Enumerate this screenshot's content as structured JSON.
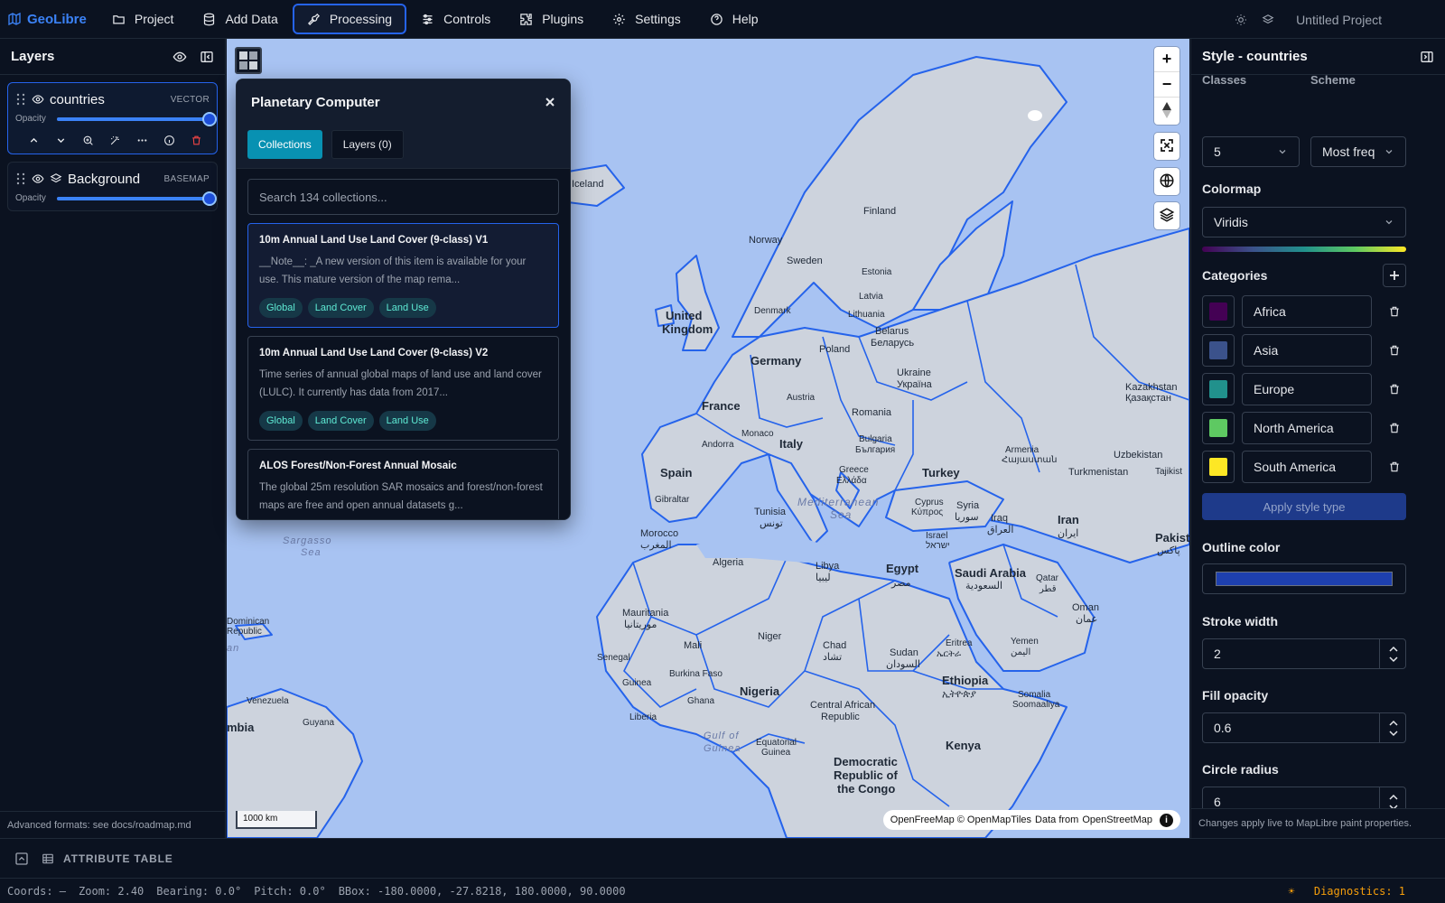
{
  "app": {
    "name": "GeoLibre",
    "project": "Untitled Project"
  },
  "menu": [
    {
      "label": "Project",
      "icon": "folder-icon"
    },
    {
      "label": "Add Data",
      "icon": "database-icon"
    },
    {
      "label": "Processing",
      "icon": "wrench-icon",
      "active": true
    },
    {
      "label": "Controls",
      "icon": "sliders-icon"
    },
    {
      "label": "Plugins",
      "icon": "puzzle-icon"
    },
    {
      "label": "Settings",
      "icon": "gear-icon"
    },
    {
      "label": "Help",
      "icon": "help-icon"
    }
  ],
  "layers_panel": {
    "title": "Layers",
    "layers": [
      {
        "name": "countries",
        "type": "VECTOR",
        "opacity_label": "Opacity",
        "opacity": 1.0
      },
      {
        "name": "Background",
        "type": "BASEMAP",
        "opacity_label": "Opacity",
        "opacity": 1.0
      }
    ],
    "footer": "Advanced formats: see docs/roadmap.md"
  },
  "planetary": {
    "title": "Planetary Computer",
    "tab_collections": "Collections",
    "tab_layers": "Layers (0)",
    "search_placeholder": "Search 134 collections...",
    "collections": [
      {
        "title": "10m Annual Land Use Land Cover (9-class) V1",
        "desc": "__Note__: _A new version of this item is available for your use. This mature version of the map rema...",
        "tags": [
          "Global",
          "Land Cover",
          "Land Use"
        ]
      },
      {
        "title": "10m Annual Land Use Land Cover (9-class) V2",
        "desc": "Time series of annual global maps of land use and land cover (LULC). It currently has data from 2017...",
        "tags": [
          "Global",
          "Land Cover",
          "Land Use"
        ]
      },
      {
        "title": "ALOS Forest/Non-Forest Annual Mosaic",
        "desc": "The global 25m resolution SAR mosaics and forest/non-forest maps are free and open annual datasets g...",
        "tags": []
      }
    ]
  },
  "map": {
    "scale": "1000 km",
    "attribution_a": "OpenFreeMap © OpenMapTiles",
    "attribution_b": "Data from",
    "attribution_c": "OpenStreetMap",
    "labels": {
      "iceland": "Iceland",
      "norway": "Norway",
      "sweden": "Sweden",
      "finland": "Finland",
      "estonia": "Estonia",
      "latvia": "Latvia",
      "lithuania": "Lithuania",
      "uk1": "United",
      "uk2": "Kingdom",
      "denmark": "Denmark",
      "belarus1": "Belarus",
      "belarus2": "Беларусь",
      "poland": "Poland",
      "germany": "Germany",
      "ukraine1": "Ukraine",
      "ukraine2": "Україна",
      "france": "France",
      "austria": "Austria",
      "romania": "Romania",
      "andorra": "Andorra",
      "monaco": "Monaco",
      "italy": "Italy",
      "bulgaria1": "Bulgaria",
      "bulgaria2": "България",
      "spain": "Spain",
      "greece1": "Greece",
      "greece2": "Ελλάδα",
      "turkey": "Turkey",
      "gibraltar": "Gibraltar",
      "kazakhstan1": "Kazakhstan",
      "kazakhstan2": "Қазақстан",
      "armenia1": "Armenia",
      "armenia2": "Հայաստան",
      "uzbekistan": "Uzbekistan",
      "turkmenistan": "Turkmenistan",
      "tajikistan": "Tajikist",
      "med1": "Mediterranean",
      "med2": "Sea",
      "tunisia1": "Tunisia",
      "tunisia2": "تونس",
      "cyprus1": "Cyprus",
      "cyprus2": "Κύπρος",
      "syria1": "Syria",
      "syria2": "سوريا",
      "iraq1": "Iraq",
      "iraq2": "العراق",
      "iran1": "Iran",
      "iran2": "ایران",
      "israel1": "Israel",
      "israel2": "ישראל",
      "morocco1": "Morocco",
      "morocco2": "المغرب",
      "sargasso1": "Sargasso",
      "sargasso2": "Sea",
      "algeria": "Algeria",
      "libya1": "Libya",
      "libya2": "ليبيا",
      "egypt1": "Egypt",
      "egypt2": "مصر",
      "saudi1": "Saudi Arabia",
      "saudi2": "السعودية",
      "qatar1": "Qatar",
      "qatar2": "قطر",
      "pakistan1": "Pakist",
      "pakistan2": "پاکس",
      "oman1": "Oman",
      "oman2": "عمان",
      "mauritania1": "Mauritania",
      "mauritania2": "موريتانيا",
      "mali": "Mali",
      "niger": "Niger",
      "chad1": "Chad",
      "chad2": "تشاد",
      "sudan1": "Sudan",
      "sudan2": "السودان",
      "eritrea1": "Eritrea",
      "eritrea2": "ኤርትራ",
      "yemen1": "Yemen",
      "yemen2": "اليمن",
      "dominican1": "Dominican",
      "dominican2": "Republic",
      "senegal": "Senegal",
      "burkina": "Burkina Faso",
      "guinea": "Guinea",
      "ghana": "Ghana",
      "nigeria": "Nigeria",
      "ethiopia1": "Ethiopia",
      "ethiopia2": "ኢትዮጵያ",
      "somalia1": "Somalia",
      "somalia2": "Soomaaliya",
      "venezuela": "Venezuela",
      "guyana": "Guyana",
      "liberia": "Liberia",
      "colombia": "mbia",
      "car1": "Central African",
      "car2": "Republic",
      "gulf1": "Gulf of",
      "gulf2": "Guinea",
      "eqguinea1": "Equatorial",
      "eqguinea2": "Guinea",
      "drc1": "Democratic",
      "drc2": "Republic of",
      "drc3": "the Congo",
      "kenya": "Kenya",
      "an": "an"
    }
  },
  "style_panel": {
    "title": "Style - countries",
    "classes_label": "Classes",
    "scheme_label": "Scheme",
    "classes_value": "5",
    "scheme_value": "Most freq",
    "colormap_label": "Colormap",
    "colormap_value": "Viridis",
    "categories_label": "Categories",
    "categories": [
      {
        "name": "Africa",
        "color": "#440154"
      },
      {
        "name": "Asia",
        "color": "#3b528b"
      },
      {
        "name": "Europe",
        "color": "#21918c"
      },
      {
        "name": "North America",
        "color": "#5ec962"
      },
      {
        "name": "South America",
        "color": "#fde725"
      }
    ],
    "apply_label": "Apply style type",
    "outline_label": "Outline color",
    "outline_color": "#1e40af",
    "stroke_label": "Stroke width",
    "stroke_value": "2",
    "fill_label": "Fill opacity",
    "fill_value": "0.6",
    "radius_label": "Circle radius",
    "radius_value": "6",
    "footer": "Changes apply live to MapLibre paint properties."
  },
  "attribute_table": {
    "label": "ATTRIBUTE TABLE"
  },
  "status": {
    "coords": "Coords: —",
    "zoom": "Zoom: 2.40",
    "bearing": "Bearing: 0.0°",
    "pitch": "Pitch: 0.0°",
    "bbox": "BBox: -180.0000, -27.8218, 180.0000, 90.0000",
    "diagnostics": "Diagnostics: 1"
  },
  "colors": {
    "accent": "#2563eb",
    "tab_active": "#0891b2",
    "map_water": "#a8c3f2",
    "land": "#c9cfd9",
    "border": "#2563eb"
  }
}
